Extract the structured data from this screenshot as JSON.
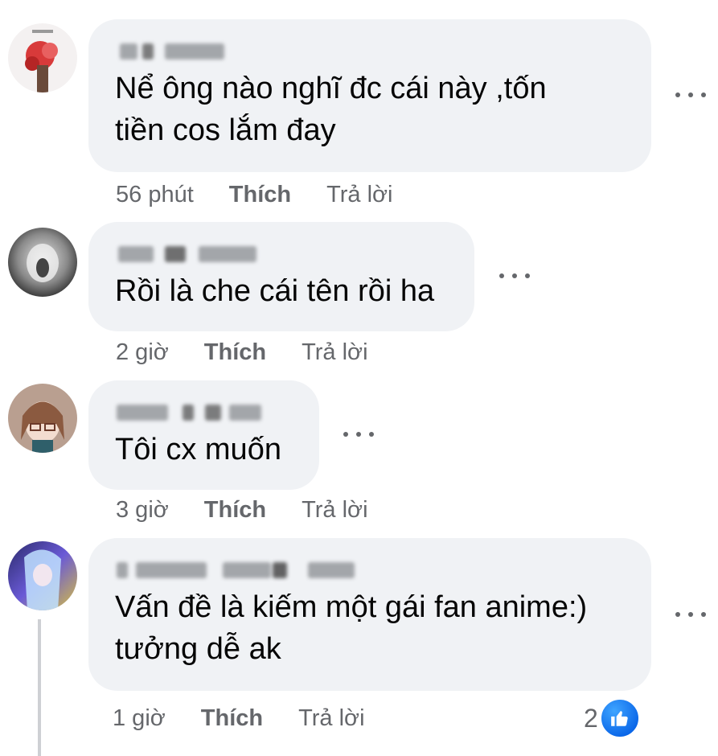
{
  "comments": [
    {
      "text": "Nể ông nào nghĩ đc cái này ,tốn\ntiền cos lắm đay",
      "time": "56 phút",
      "like": "Thích",
      "reply": "Trả lời"
    },
    {
      "text": "Rồi là che cái tên rồi ha",
      "time": "2 giờ",
      "like": "Thích",
      "reply": "Trả lời"
    },
    {
      "text": "Tôi cx muốn",
      "time": "3 giờ",
      "like": "Thích",
      "reply": "Trả lời"
    },
    {
      "text": "Vấn đề là kiếm một gái fan anime:)\ntưởng dễ ak",
      "time": "1 giờ",
      "like": "Thích",
      "reply": "Trả lời",
      "reaction_count": "2"
    }
  ],
  "icons": {
    "more": "more-options-icon",
    "reaction": "like-reaction-icon"
  },
  "colors": {
    "bubble": "#f0f2f5",
    "secondary_text": "#65676b",
    "like_blue": "#0a66e8"
  }
}
